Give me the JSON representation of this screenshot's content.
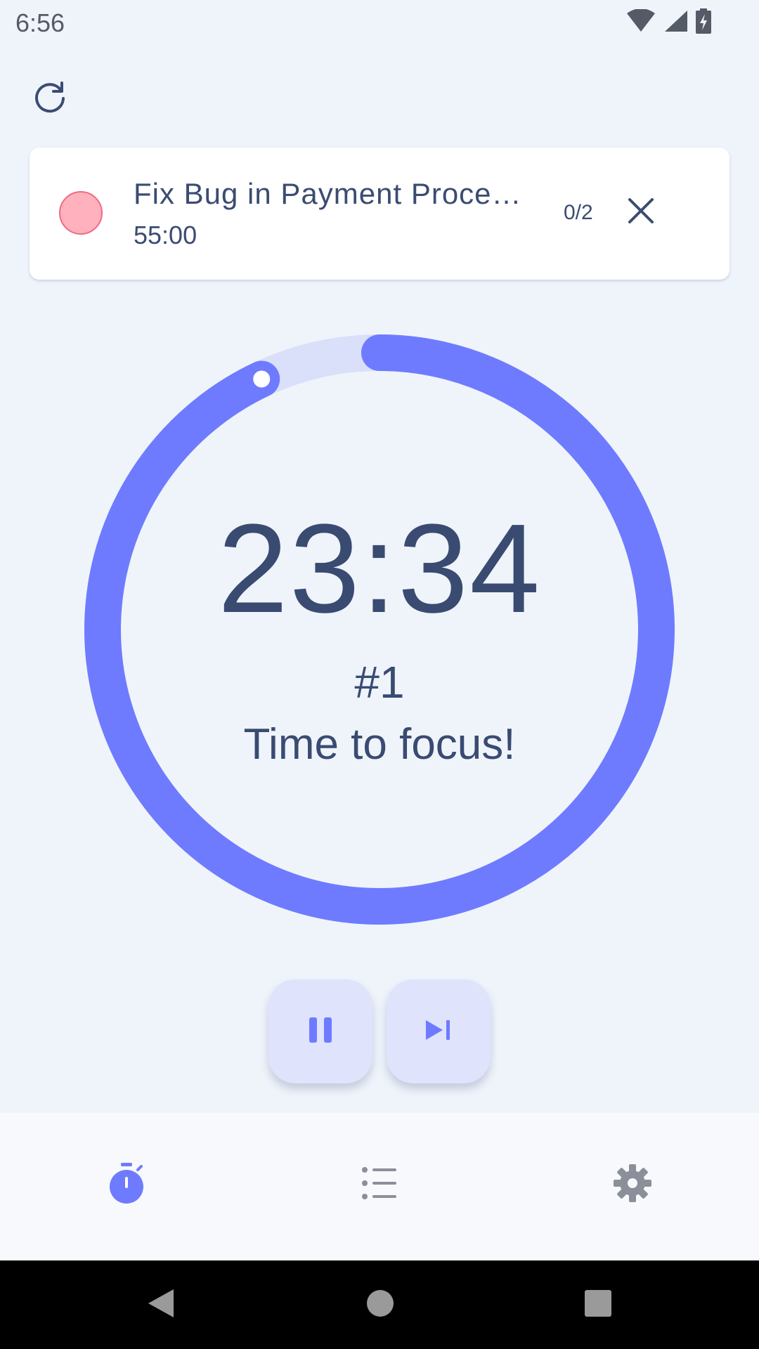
{
  "status_bar": {
    "time": "6:56",
    "icons": [
      "wifi-icon",
      "cellular-signal-icon",
      "battery-charging-icon"
    ]
  },
  "toolbar": {
    "refresh_icon": "refresh-icon"
  },
  "task": {
    "title": "Fix Bug in Payment Proces…",
    "duration": "55:00",
    "progress": "0/2",
    "color": "#ffb1bd",
    "close_icon": "close-icon"
  },
  "timer": {
    "time": "23:34",
    "round": "#1",
    "label": "Time to focus!",
    "remaining_fraction": 0.93,
    "ring_color": "#6e7bff",
    "track_color": "#dadffa"
  },
  "controls": {
    "pause_icon": "pause-icon",
    "skip_icon": "skip-next-icon"
  },
  "bottom_nav": {
    "items": [
      {
        "name": "timer",
        "icon": "stopwatch-icon",
        "active": true
      },
      {
        "name": "tasks",
        "icon": "list-icon",
        "active": false
      },
      {
        "name": "settings",
        "icon": "gear-icon",
        "active": false
      }
    ],
    "active_color": "#6e7bff",
    "inactive_color": "#8a8f99"
  },
  "system_nav": {
    "icons": [
      "back-icon",
      "home-icon",
      "recents-icon"
    ]
  }
}
